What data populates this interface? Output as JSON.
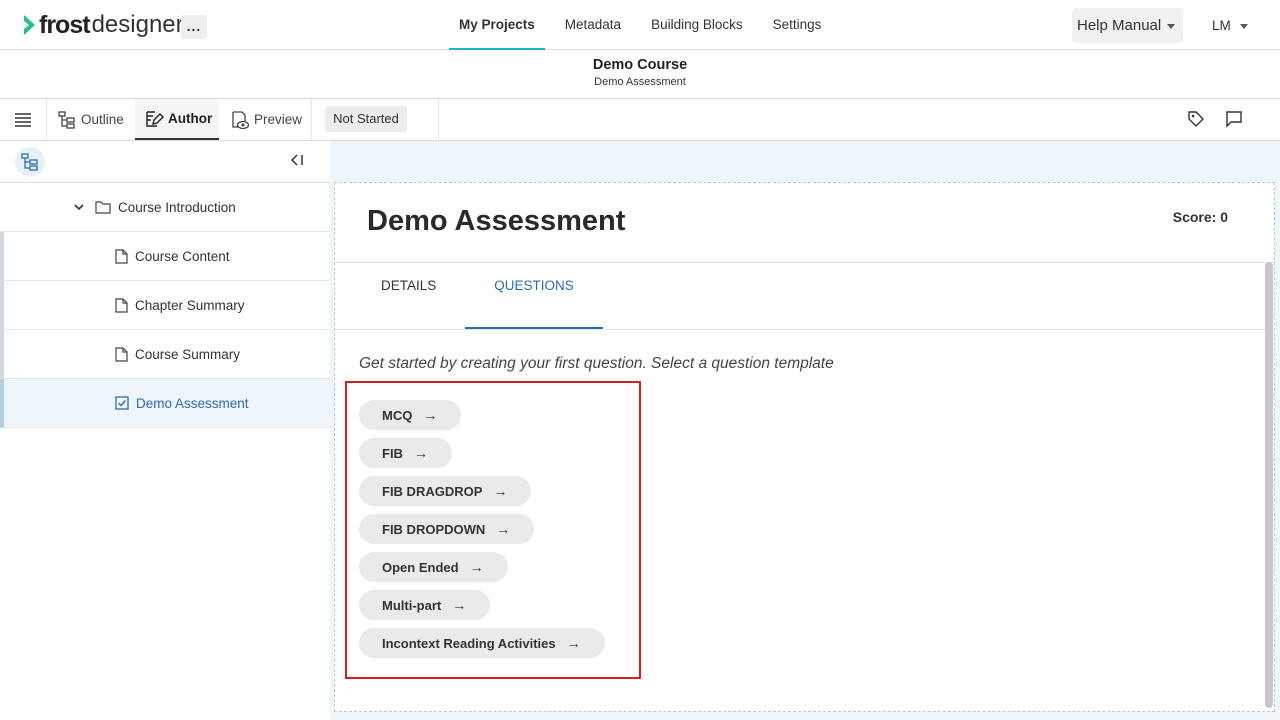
{
  "app": {
    "logo_frost": "frost",
    "logo_designer": "designer",
    "more_label": "..."
  },
  "nav": {
    "items": [
      {
        "label": "My Projects",
        "active": true
      },
      {
        "label": "Metadata",
        "active": false
      },
      {
        "label": "Building Blocks",
        "active": false
      },
      {
        "label": "Settings",
        "active": false
      }
    ]
  },
  "header_right": {
    "help_label": "Help Manual",
    "user_initials": "LM"
  },
  "course": {
    "title": "Demo Course",
    "subtitle": "Demo Assessment"
  },
  "toolbar": {
    "tabs": [
      {
        "label": "Outline",
        "icon": "outline-icon",
        "active": false
      },
      {
        "label": "Author",
        "icon": "author-icon",
        "active": true
      },
      {
        "label": "Preview",
        "icon": "preview-icon",
        "active": false
      }
    ],
    "status": "Not Started",
    "right_icons": [
      "tag-icon",
      "comment-icon"
    ]
  },
  "sidebar": {
    "collapse_label": "<I",
    "items": [
      {
        "label": "Course Introduction",
        "icon": "folder-icon",
        "level": 0
      },
      {
        "label": "Course Content",
        "icon": "file-icon",
        "level": 1
      },
      {
        "label": "Chapter Summary",
        "icon": "file-icon",
        "level": 1
      },
      {
        "label": "Course Summary",
        "icon": "file-icon",
        "level": 1
      },
      {
        "label": "Demo Assessment",
        "icon": "checkbox-icon",
        "level": 1,
        "selected": true
      }
    ]
  },
  "main": {
    "title": "Demo Assessment",
    "score": "Score: 0",
    "tabs": [
      {
        "label": "DETAILS",
        "active": false
      },
      {
        "label": "QUESTIONS",
        "active": true
      }
    ],
    "hint": "Get started by creating your first question. Select a question template",
    "templates": [
      "MCQ",
      "FIB",
      "FIB DRAGDROP",
      "FIB DROPDOWN",
      "Open Ended",
      "Multi-part",
      "Incontext Reading Activities"
    ],
    "arrow": "→"
  },
  "colors": {
    "accent": "#1bb3c6",
    "link_blue": "#2b6cb0",
    "highlight_red": "#d31f1f",
    "main_bg": "#eef5fb"
  }
}
